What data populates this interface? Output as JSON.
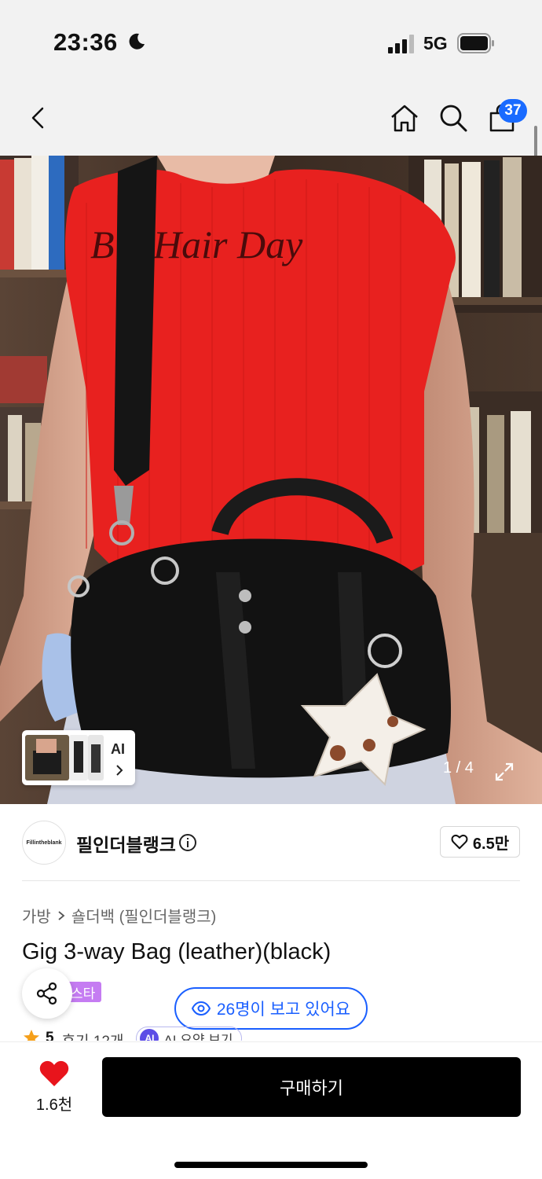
{
  "status_bar": {
    "time": "23:36",
    "network": "5G"
  },
  "nav": {
    "cart_count": "37"
  },
  "gallery": {
    "thumb_ai_label": "AI",
    "counter": "1 / 4"
  },
  "brand": {
    "logo_text": "Fillintheblank",
    "name": "필인더블랭크",
    "likes": "6.5만"
  },
  "product": {
    "breadcrumb": [
      "가방",
      "숄더백 (필인더블랭크)"
    ],
    "title": "Gig 3-way Bag (leather)(black)",
    "badge": "스타",
    "viewers": "26명이 보고 있어요",
    "rating": "5",
    "reviews": "후기 12개",
    "ai_badge": "AI",
    "ai_summary": "AI 요약 보기"
  },
  "bottom_bar": {
    "wish_count": "1.6천",
    "buy_label": "구매하기"
  },
  "colors": {
    "accent_blue": "#1a5fff",
    "badge_blue": "#1a6bff",
    "heart_red": "#e8141c",
    "badge_purple": "#c57cf2"
  }
}
